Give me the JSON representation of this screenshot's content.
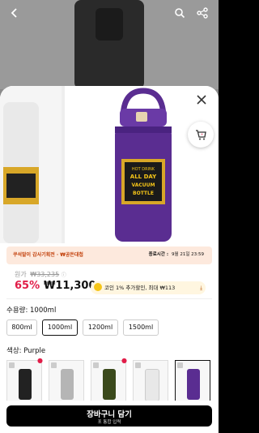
{
  "header": {
    "back_icon": "back-arrow-icon",
    "search_icon": "search-icon",
    "share_icon": "share-icon"
  },
  "sheet": {
    "close_icon": "close-icon",
    "cart_icon": "cart-icon",
    "product_label_lines": [
      "HOT DRINK",
      "ALL DAY",
      "VACUUM",
      "BOTTLE"
    ]
  },
  "promo": {
    "left": "쿠석말이 감사기획전 · ₩공돈대첩",
    "right_label": "종료시간 :",
    "right_time": "9월 21일 23:59"
  },
  "price": {
    "original_label": "원가",
    "original_price": "₩33,235",
    "discount": "65%",
    "sale_price": "₩11,300",
    "coupon_text": "코인 1% 추가할인, 최대 ₩113",
    "coupon_icon": "coin-icon",
    "download_icon": "download-arrow-icon"
  },
  "capacity": {
    "label": "수용량: 1000ml",
    "options": [
      "800ml",
      "1000ml",
      "1200ml",
      "1500ml"
    ],
    "selected_index": 1
  },
  "color": {
    "label": "색상: Purple",
    "thumb_colors": [
      "#222222",
      "#b5b5b5",
      "#3b4a1c",
      "#e8e8e8",
      "#5a2d91"
    ],
    "selected_index": 4
  },
  "cta": {
    "title": "장바구니 담기",
    "subtitle": "포 통합 입력"
  },
  "colors": {
    "accent_red": "#e11d48",
    "bottle_purple": "#5a2d91",
    "label_gold": "#d8a728"
  }
}
